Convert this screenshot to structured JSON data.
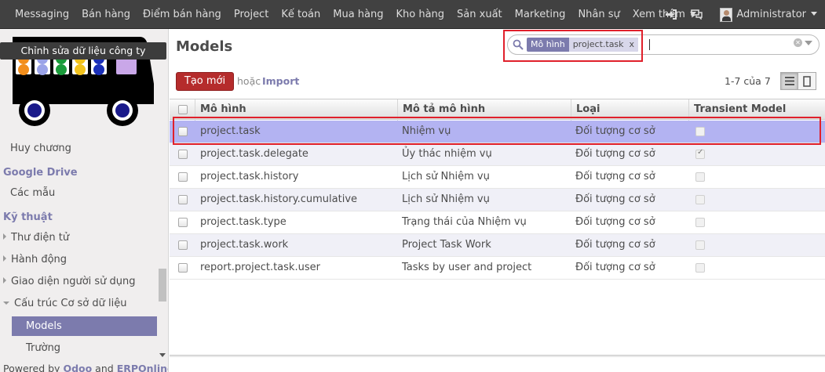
{
  "topbar": {
    "menu": [
      "Messaging",
      "Bán hàng",
      "Điểm bán hàng",
      "Project",
      "Kế toán",
      "Mua hàng",
      "Kho hàng",
      "Sản xuất",
      "Marketing",
      "Nhân sự",
      "Xem thêm"
    ],
    "user": "Administrator",
    "icons": [
      "sign-in-icon",
      "chat-icon"
    ]
  },
  "sidebar": {
    "company_tooltip": "Chỉnh sửa dữ liệu công ty",
    "items_top": [
      "Huy chương"
    ],
    "section_google": "Google Drive",
    "items_google": [
      "Các mẫu"
    ],
    "section_tech": "Kỹ thuật",
    "items_tech": [
      "Thư điện tử",
      "Hành động",
      "Giao diện người sử dụng",
      "Cấu trúc Cơ sở dữ liệu"
    ],
    "active_item": "Models",
    "after_active": "Trường",
    "powered_prefix": "Powered by",
    "powered_odoo": "Odoo",
    "powered_and": "and",
    "powered_erp": "ERPOnline"
  },
  "main": {
    "title": "Models",
    "search": {
      "facet_category": "Mô hình",
      "facet_value": "project.task",
      "facet_remove": "x"
    },
    "create_button": "Tạo mới",
    "or_text": "hoặc",
    "import_link": "Import",
    "pager": "1-7 của 7"
  },
  "table": {
    "columns": [
      "Mô hình",
      "Mô tả mô hình",
      "Loại",
      "Transient Model"
    ],
    "rows": [
      {
        "model": "project.task",
        "desc": "Nhiệm vụ",
        "type": "Đối tượng cơ sở",
        "transient": false,
        "selected": true
      },
      {
        "model": "project.task.delegate",
        "desc": "Ủy thác nhiệm vụ",
        "type": "Đối tượng cơ sở",
        "transient": true,
        "selected": false
      },
      {
        "model": "project.task.history",
        "desc": "Lịch sử Nhiệm vụ",
        "type": "Đối tượng cơ sở",
        "transient": false,
        "selected": false
      },
      {
        "model": "project.task.history.cumulative",
        "desc": "Lịch sử Nhiệm vụ",
        "type": "Đối tượng cơ sở",
        "transient": false,
        "selected": false
      },
      {
        "model": "project.task.type",
        "desc": "Trạng thái của Nhiệm vụ",
        "type": "Đối tượng cơ sở",
        "transient": false,
        "selected": false
      },
      {
        "model": "project.task.work",
        "desc": "Project Task Work",
        "type": "Đối tượng cơ sở",
        "transient": false,
        "selected": false
      },
      {
        "model": "report.project.task.user",
        "desc": "Tasks by user and project",
        "type": "Đối tượng cơ sở",
        "transient": false,
        "selected": false
      }
    ]
  },
  "colors": {
    "accent": "#7c7bad",
    "create_button": "#b52c2c",
    "highlight": "#e0202b",
    "selected_row": "#b3b3f2"
  }
}
